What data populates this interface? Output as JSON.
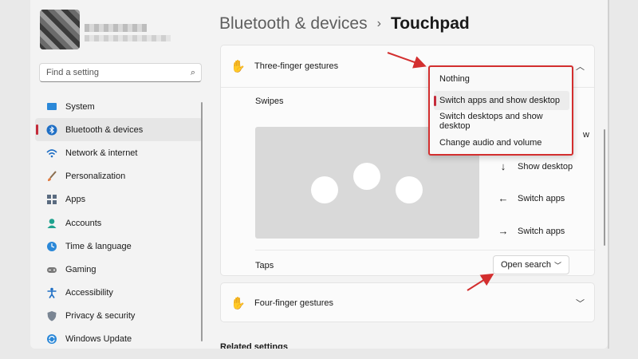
{
  "sidebar": {
    "search_placeholder": "Find a setting",
    "items": [
      {
        "label": "System",
        "icon": "monitor-icon"
      },
      {
        "label": "Bluetooth & devices",
        "icon": "bluetooth-icon"
      },
      {
        "label": "Network & internet",
        "icon": "wifi-icon"
      },
      {
        "label": "Personalization",
        "icon": "brush-icon"
      },
      {
        "label": "Apps",
        "icon": "apps-icon"
      },
      {
        "label": "Accounts",
        "icon": "person-icon"
      },
      {
        "label": "Time & language",
        "icon": "globe-clock-icon"
      },
      {
        "label": "Gaming",
        "icon": "controller-icon"
      },
      {
        "label": "Accessibility",
        "icon": "accessibility-icon"
      },
      {
        "label": "Privacy & security",
        "icon": "shield-icon"
      },
      {
        "label": "Windows Update",
        "icon": "update-icon"
      }
    ],
    "active_index": 1
  },
  "header": {
    "parent": "Bluetooth & devices",
    "separator": "›",
    "current": "Touchpad"
  },
  "three_finger": {
    "title": "Three-finger gestures",
    "swipes_label": "Swipes",
    "gestures": [
      {
        "direction": "up",
        "label": "w"
      },
      {
        "direction": "down",
        "label": "Show desktop"
      },
      {
        "direction": "left",
        "label": "Switch apps"
      },
      {
        "direction": "right",
        "label": "Switch apps"
      }
    ],
    "taps_label": "Taps",
    "taps_value": "Open search"
  },
  "four_finger": {
    "title": "Four-finger gestures"
  },
  "related": "Related settings",
  "swipe_menu": {
    "options": [
      "Nothing",
      "Switch apps and show desktop",
      "Switch desktops and show desktop",
      "Change audio and volume"
    ],
    "selected_index": 1
  },
  "colors": {
    "accent": "#c42b3a",
    "annotation": "#d32f2f"
  }
}
